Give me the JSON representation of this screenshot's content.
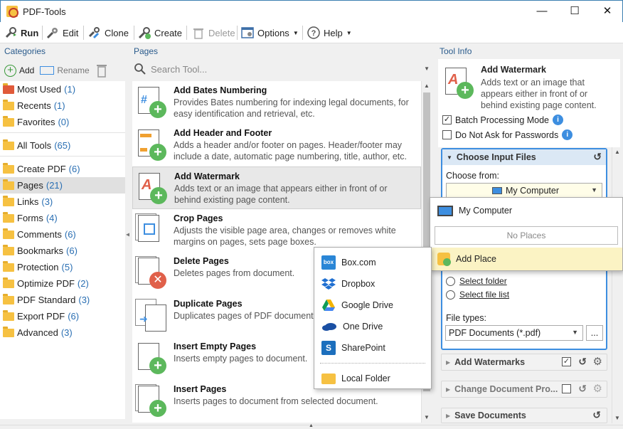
{
  "window": {
    "title": "PDF-Tools",
    "minimize": "—",
    "maximize": "☐",
    "close": "✕"
  },
  "toolbar": {
    "run": "Run",
    "edit": "Edit",
    "clone": "Clone",
    "create": "Create",
    "delete": "Delete",
    "options": "Options",
    "help": "Help"
  },
  "categories": {
    "title": "Categories",
    "add": "Add",
    "rename": "Rename",
    "items_top": [
      {
        "label": "Most Used",
        "count": "(1)"
      },
      {
        "label": "Recents",
        "count": "(1)"
      },
      {
        "label": "Favorites",
        "count": "(0)"
      }
    ],
    "all": {
      "label": "All Tools",
      "count": "(65)"
    },
    "items": [
      {
        "label": "Create PDF",
        "count": "(6)"
      },
      {
        "label": "Pages",
        "count": "(21)"
      },
      {
        "label": "Links",
        "count": "(3)"
      },
      {
        "label": "Forms",
        "count": "(4)"
      },
      {
        "label": "Comments",
        "count": "(6)"
      },
      {
        "label": "Bookmarks",
        "count": "(6)"
      },
      {
        "label": "Protection",
        "count": "(5)"
      },
      {
        "label": "Optimize PDF",
        "count": "(2)"
      },
      {
        "label": "PDF Standard",
        "count": "(3)"
      },
      {
        "label": "Export PDF",
        "count": "(6)"
      },
      {
        "label": "Advanced",
        "count": "(3)"
      }
    ]
  },
  "pages": {
    "title": "Pages",
    "search_placeholder": "Search Tool...",
    "items": [
      {
        "name": "Add Bates Numbering",
        "desc": "Provides Bates numbering for indexing legal documents, for easy identification and retrieval, etc."
      },
      {
        "name": "Add Header and Footer",
        "desc": "Adds a header and/or footer on pages. Header/footer may include a date, automatic page numbering, title, author, etc."
      },
      {
        "name": "Add Watermark",
        "desc": "Adds text or an image that appears either in front of or behind existing page content."
      },
      {
        "name": "Crop Pages",
        "desc": "Adjusts the visible page area, changes or removes white margins on pages, sets page boxes."
      },
      {
        "name": "Delete Pages",
        "desc": "Deletes pages from document."
      },
      {
        "name": "Duplicate Pages",
        "desc": "Duplicates pages of PDF document."
      },
      {
        "name": "Insert Empty Pages",
        "desc": "Inserts empty pages to document."
      },
      {
        "name": "Insert Pages",
        "desc": "Inserts pages to document from selected document."
      }
    ]
  },
  "cloud_menu": {
    "items": [
      {
        "label": "Box.com",
        "icon": "box-icon",
        "color": "#2a86d6"
      },
      {
        "label": "Dropbox",
        "icon": "dropbox-icon",
        "color": "#1f6fd1"
      },
      {
        "label": "Google Drive",
        "icon": "google-drive-icon",
        "color": "#f4b400"
      },
      {
        "label": "One Drive",
        "icon": "onedrive-icon",
        "color": "#1a4fa3"
      },
      {
        "label": "SharePoint",
        "icon": "sharepoint-icon",
        "color": "#1c6fbd"
      }
    ],
    "local": "Local Folder"
  },
  "tool_info": {
    "title": "Tool Info",
    "name": "Add Watermark",
    "desc": "Adds text or an image that appears either in front of or behind existing page content.",
    "batch": "Batch Processing Mode",
    "no_ask": "Do Not Ask for Passwords",
    "input_group": "Choose Input Files",
    "choose_from": "Choose from:",
    "combo_value": "My Computer",
    "select_folder": "Select folder",
    "select_file_list": "Select file list",
    "file_types_label": "File types:",
    "file_types_value": "PDF Documents (*.pdf)",
    "browse": "...",
    "add_watermarks": "Add Watermarks",
    "change_doc": "Change Document Pro...",
    "save_docs": "Save Documents"
  },
  "places_menu": {
    "my_computer": "My Computer",
    "no_places": "No Places",
    "add_place": "Add Place"
  }
}
